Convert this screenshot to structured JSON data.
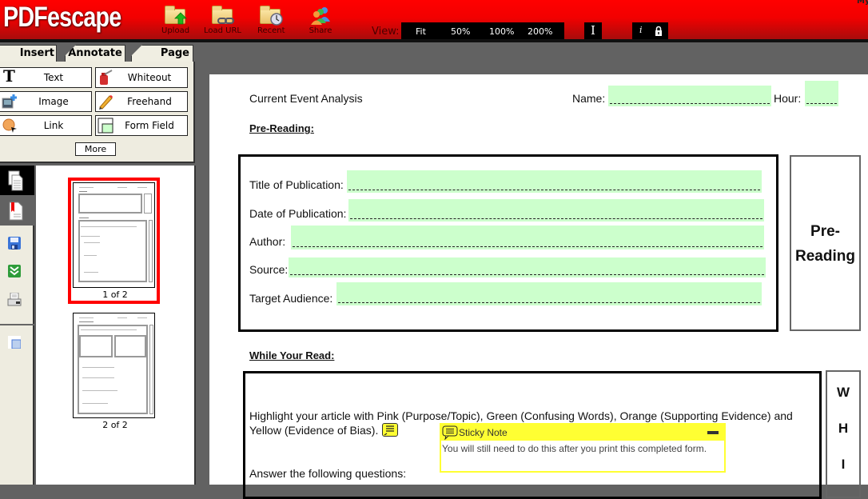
{
  "app": {
    "logo": "PDFescape",
    "corner_text": "My"
  },
  "toolbar": {
    "buttons": [
      {
        "label": "Upload",
        "icon": "folder-upload-icon"
      },
      {
        "label": "Load URL",
        "icon": "folder-link-icon"
      },
      {
        "label": "Recent",
        "icon": "folder-clock-icon"
      },
      {
        "label": "Share",
        "icon": "share-users-icon"
      }
    ],
    "view_label": "View:",
    "zoom_options": [
      "Fit",
      "50%",
      "100%",
      "200%"
    ],
    "cursor_glyph": "I",
    "info_glyph": "i",
    "colors": {
      "bar_top": "#ff0000",
      "bar_bottom": "#a80c0c"
    }
  },
  "left_panel": {
    "tabs": [
      {
        "label": "Insert",
        "active": true
      },
      {
        "label": "Annotate",
        "active": false
      },
      {
        "label": "Page",
        "active": false
      }
    ],
    "tools": [
      {
        "label": "Text",
        "icon": "text-icon"
      },
      {
        "label": "Whiteout",
        "icon": "whiteout-icon"
      },
      {
        "label": "Image",
        "icon": "image-icon"
      },
      {
        "label": "Freehand",
        "icon": "pencil-icon"
      },
      {
        "label": "Link",
        "icon": "link-icon"
      },
      {
        "label": "Form Field",
        "icon": "form-field-icon"
      }
    ],
    "more_label": "More",
    "side_icons": [
      "pages-icon",
      "bookmark-icon",
      "save-icon",
      "download-icon",
      "print-icon",
      "window-icon"
    ],
    "thumbnails": [
      {
        "label": "1 of 2",
        "selected": true
      },
      {
        "label": "2 of 2",
        "selected": false
      }
    ]
  },
  "document": {
    "title": "Current Event Analysis",
    "name_label": "Name:",
    "hour_label": "Hour:",
    "name_value": "",
    "hour_value": "",
    "pre_reading_heading": "Pre-Reading:",
    "fields": [
      {
        "label": "Title of Publication:",
        "value": ""
      },
      {
        "label": "Date of Publication:",
        "value": ""
      },
      {
        "label": "Author:",
        "value": ""
      },
      {
        "label": "Source:",
        "value": ""
      },
      {
        "label": "Target Audience:",
        "value": ""
      }
    ],
    "pre_reading_side_line1": "Pre-",
    "pre_reading_side_line2": "Reading",
    "while_heading": "While Your Read:",
    "highlight_line1": "Highlight your article with Pink (Purpose/Topic), Green (Confusing Words), Orange (Supporting Evidence) and",
    "highlight_line2": "Yellow (Evidence of Bias).",
    "answer_text": "Answer the following questions:",
    "side_letters": [
      "W",
      "H",
      "I"
    ],
    "field_color": "#ccffcc"
  },
  "sticky_note": {
    "title": "Sticky Note",
    "body": "You will still need to do this after you print this completed form.",
    "color": "#ffff33"
  }
}
